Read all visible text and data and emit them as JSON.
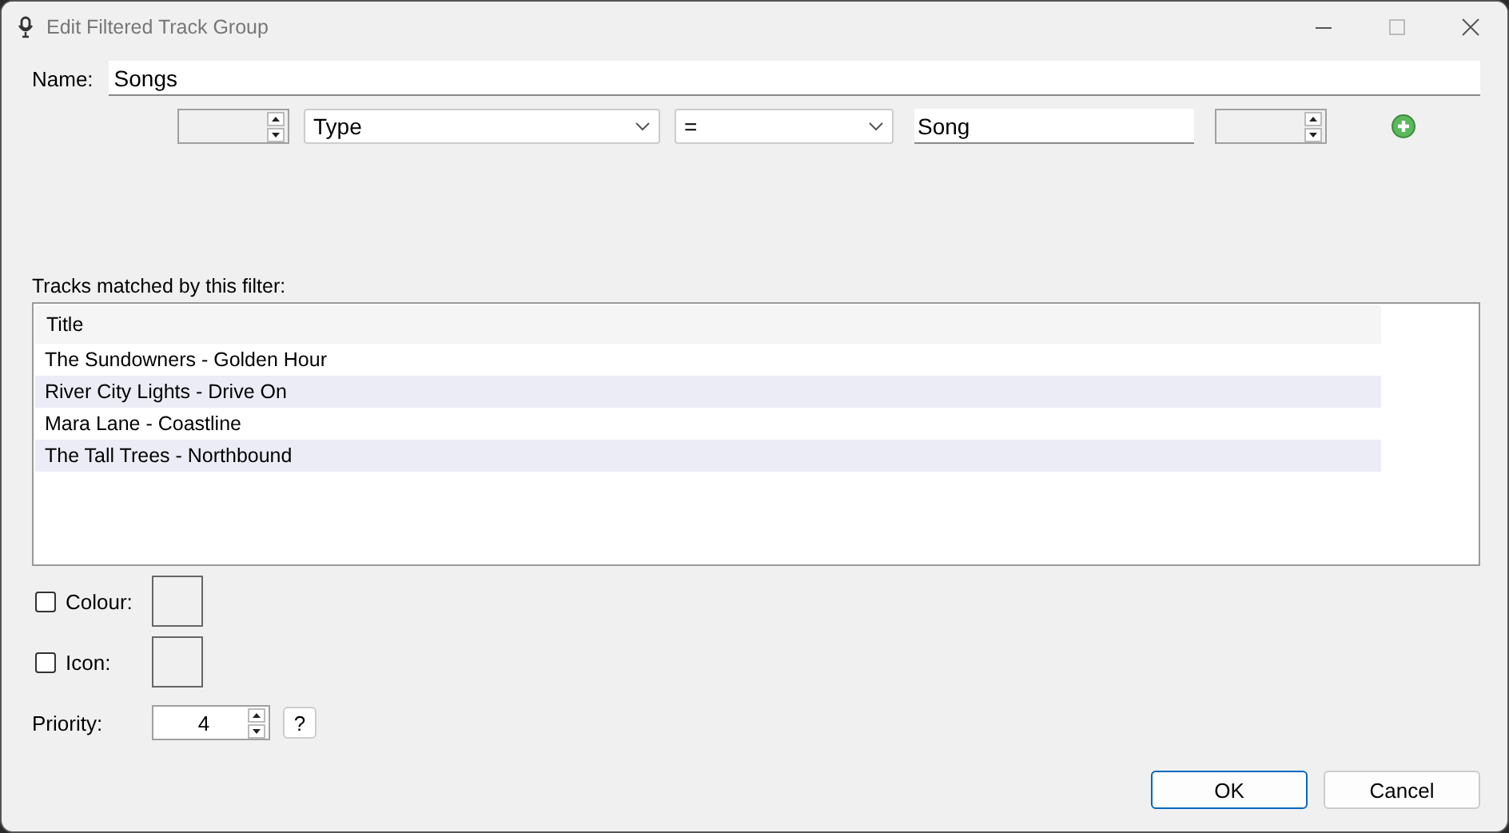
{
  "window": {
    "title": "Edit Filtered Track Group"
  },
  "name": {
    "label": "Name:",
    "value": "Songs"
  },
  "filter": {
    "field": "Type",
    "operator": "=",
    "value": "Song"
  },
  "tracks": {
    "label": "Tracks matched by this filter:",
    "columns": [
      "Title"
    ],
    "rows": [
      {
        "title": "The Sundowners - Golden Hour"
      },
      {
        "title": "River City Lights - Drive On"
      },
      {
        "title": "Mara Lane - Coastline"
      },
      {
        "title": "The Tall Trees - Northbound"
      }
    ]
  },
  "options": [
    {
      "label": "Colour:",
      "checked": false
    },
    {
      "label": "Icon:",
      "checked": false
    }
  ],
  "priority": {
    "label": "Priority:",
    "value": "4",
    "help": "?"
  },
  "buttons": [
    {
      "label": "OK",
      "default": true
    },
    {
      "label": "Cancel",
      "default": false
    }
  ]
}
